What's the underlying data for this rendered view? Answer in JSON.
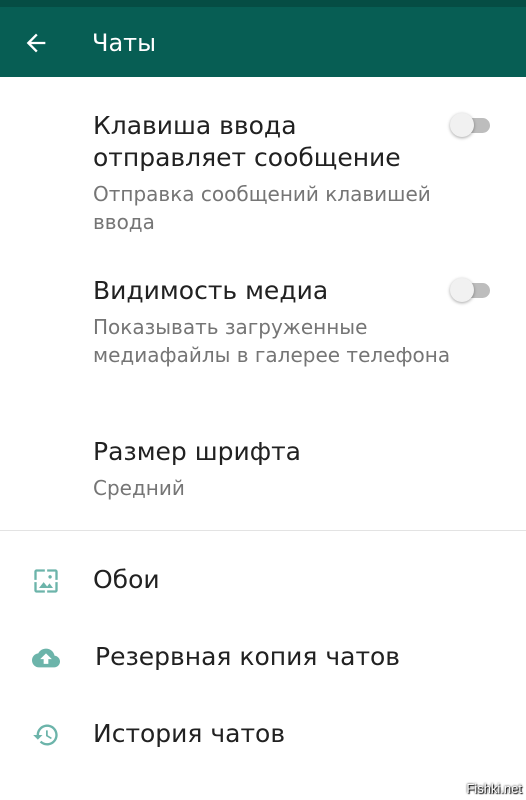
{
  "colors": {
    "appbar": "#075e54",
    "statusbar": "#054d44",
    "icon_tint": "#6cb4aa",
    "toggle_track": "#bdbdbd",
    "toggle_thumb": "#f1f1f1"
  },
  "appbar": {
    "title": "Чаты",
    "back_icon": "arrow-left-icon"
  },
  "settings": [
    {
      "title": "Клавиша ввода отправляет сообщение",
      "subtitle": "Отправка сообщений клавишей ввода",
      "toggle": "off"
    },
    {
      "title": "Видимость медиа",
      "subtitle": "Показывать загруженные медиафайлы в галерее телефона",
      "toggle": "off"
    },
    {
      "title": "Размер шрифта",
      "subtitle": "Средний"
    }
  ],
  "rows": [
    {
      "label": "Обои",
      "icon": "wallpaper-icon"
    },
    {
      "label": "Резервная копия чатов",
      "icon": "cloud-upload-icon"
    },
    {
      "label": "История чатов",
      "icon": "history-icon"
    }
  ],
  "watermark": "Fishki.net"
}
